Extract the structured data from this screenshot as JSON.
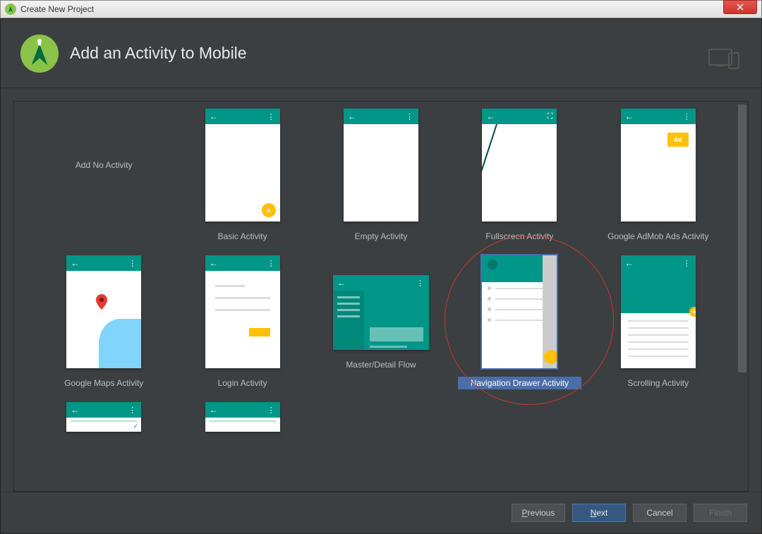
{
  "window": {
    "title": "Create New Project"
  },
  "header": {
    "title": "Add an Activity to Mobile"
  },
  "gallery": {
    "items": [
      {
        "label": "Add No Activity",
        "type": "none"
      },
      {
        "label": "Basic Activity",
        "type": "basic"
      },
      {
        "label": "Empty Activity",
        "type": "empty"
      },
      {
        "label": "Fullscreen Activity",
        "type": "fullscreen"
      },
      {
        "label": "Google AdMob Ads Activity",
        "type": "admob",
        "ad_text": "Ad"
      },
      {
        "label": "Google Maps Activity",
        "type": "maps"
      },
      {
        "label": "Login Activity",
        "type": "login"
      },
      {
        "label": "Master/Detail Flow",
        "type": "master"
      },
      {
        "label": "Navigation Drawer Activity",
        "type": "navdrawer",
        "selected": true
      },
      {
        "label": "Scrolling Activity",
        "type": "scrolling"
      }
    ],
    "partial_row": [
      {
        "type": "small1"
      },
      {
        "type": "small2"
      }
    ]
  },
  "footer": {
    "previous": "Previous",
    "next": "Next",
    "cancel": "Cancel",
    "finish": "Finish"
  }
}
